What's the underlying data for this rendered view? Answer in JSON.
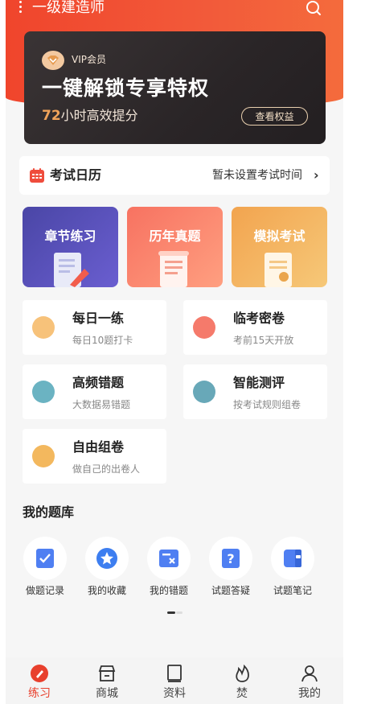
{
  "header": {
    "title": "一级建造师"
  },
  "vip": {
    "label": "VIP会员",
    "title": "一键解锁专享特权",
    "subtitle_num": "72",
    "subtitle_text": "小时高效提分",
    "button": "查看权益"
  },
  "calendar": {
    "title": "考试日历",
    "status": "暂未设置考试时间",
    "arrow": "›"
  },
  "cards": [
    {
      "label": "章节练习",
      "color": "#5249b5"
    },
    {
      "label": "历年真题",
      "color": "#f8826a"
    },
    {
      "label": "模拟考试",
      "color": "#f3b55e"
    }
  ],
  "features": [
    {
      "title": "每日一练",
      "subtitle": "每日10题打卡",
      "icon": "daily-practice-icon"
    },
    {
      "title": "临考密卷",
      "subtitle": "考前15天开放",
      "icon": "secret-paper-icon"
    },
    {
      "title": "高频错题",
      "subtitle": "大数据易错题",
      "icon": "frequent-errors-icon"
    },
    {
      "title": "智能测评",
      "subtitle": "按考试规则组卷",
      "icon": "smart-assessment-icon"
    },
    {
      "title": "自由组卷",
      "subtitle": "做自己的出卷人",
      "icon": "free-paper-icon"
    }
  ],
  "bank": {
    "title": "我的题库",
    "items": [
      {
        "label": "做题记录",
        "icon": "record-icon"
      },
      {
        "label": "我的收藏",
        "icon": "star-icon"
      },
      {
        "label": "我的错题",
        "icon": "wrong-icon"
      },
      {
        "label": "试题答疑",
        "icon": "question-icon"
      },
      {
        "label": "试题笔记",
        "icon": "notes-icon"
      }
    ]
  },
  "tabs": [
    {
      "label": "练习",
      "icon": "practice-icon",
      "active": true
    },
    {
      "label": "商城",
      "icon": "store-icon"
    },
    {
      "label": "资料",
      "icon": "materials-icon"
    },
    {
      "label": "焚",
      "icon": "flame-icon"
    },
    {
      "label": "我的",
      "icon": "profile-icon"
    }
  ],
  "colors": {
    "accent": "#e8402d",
    "header": "#f0452c",
    "vip_gold": "#f0a35a"
  }
}
